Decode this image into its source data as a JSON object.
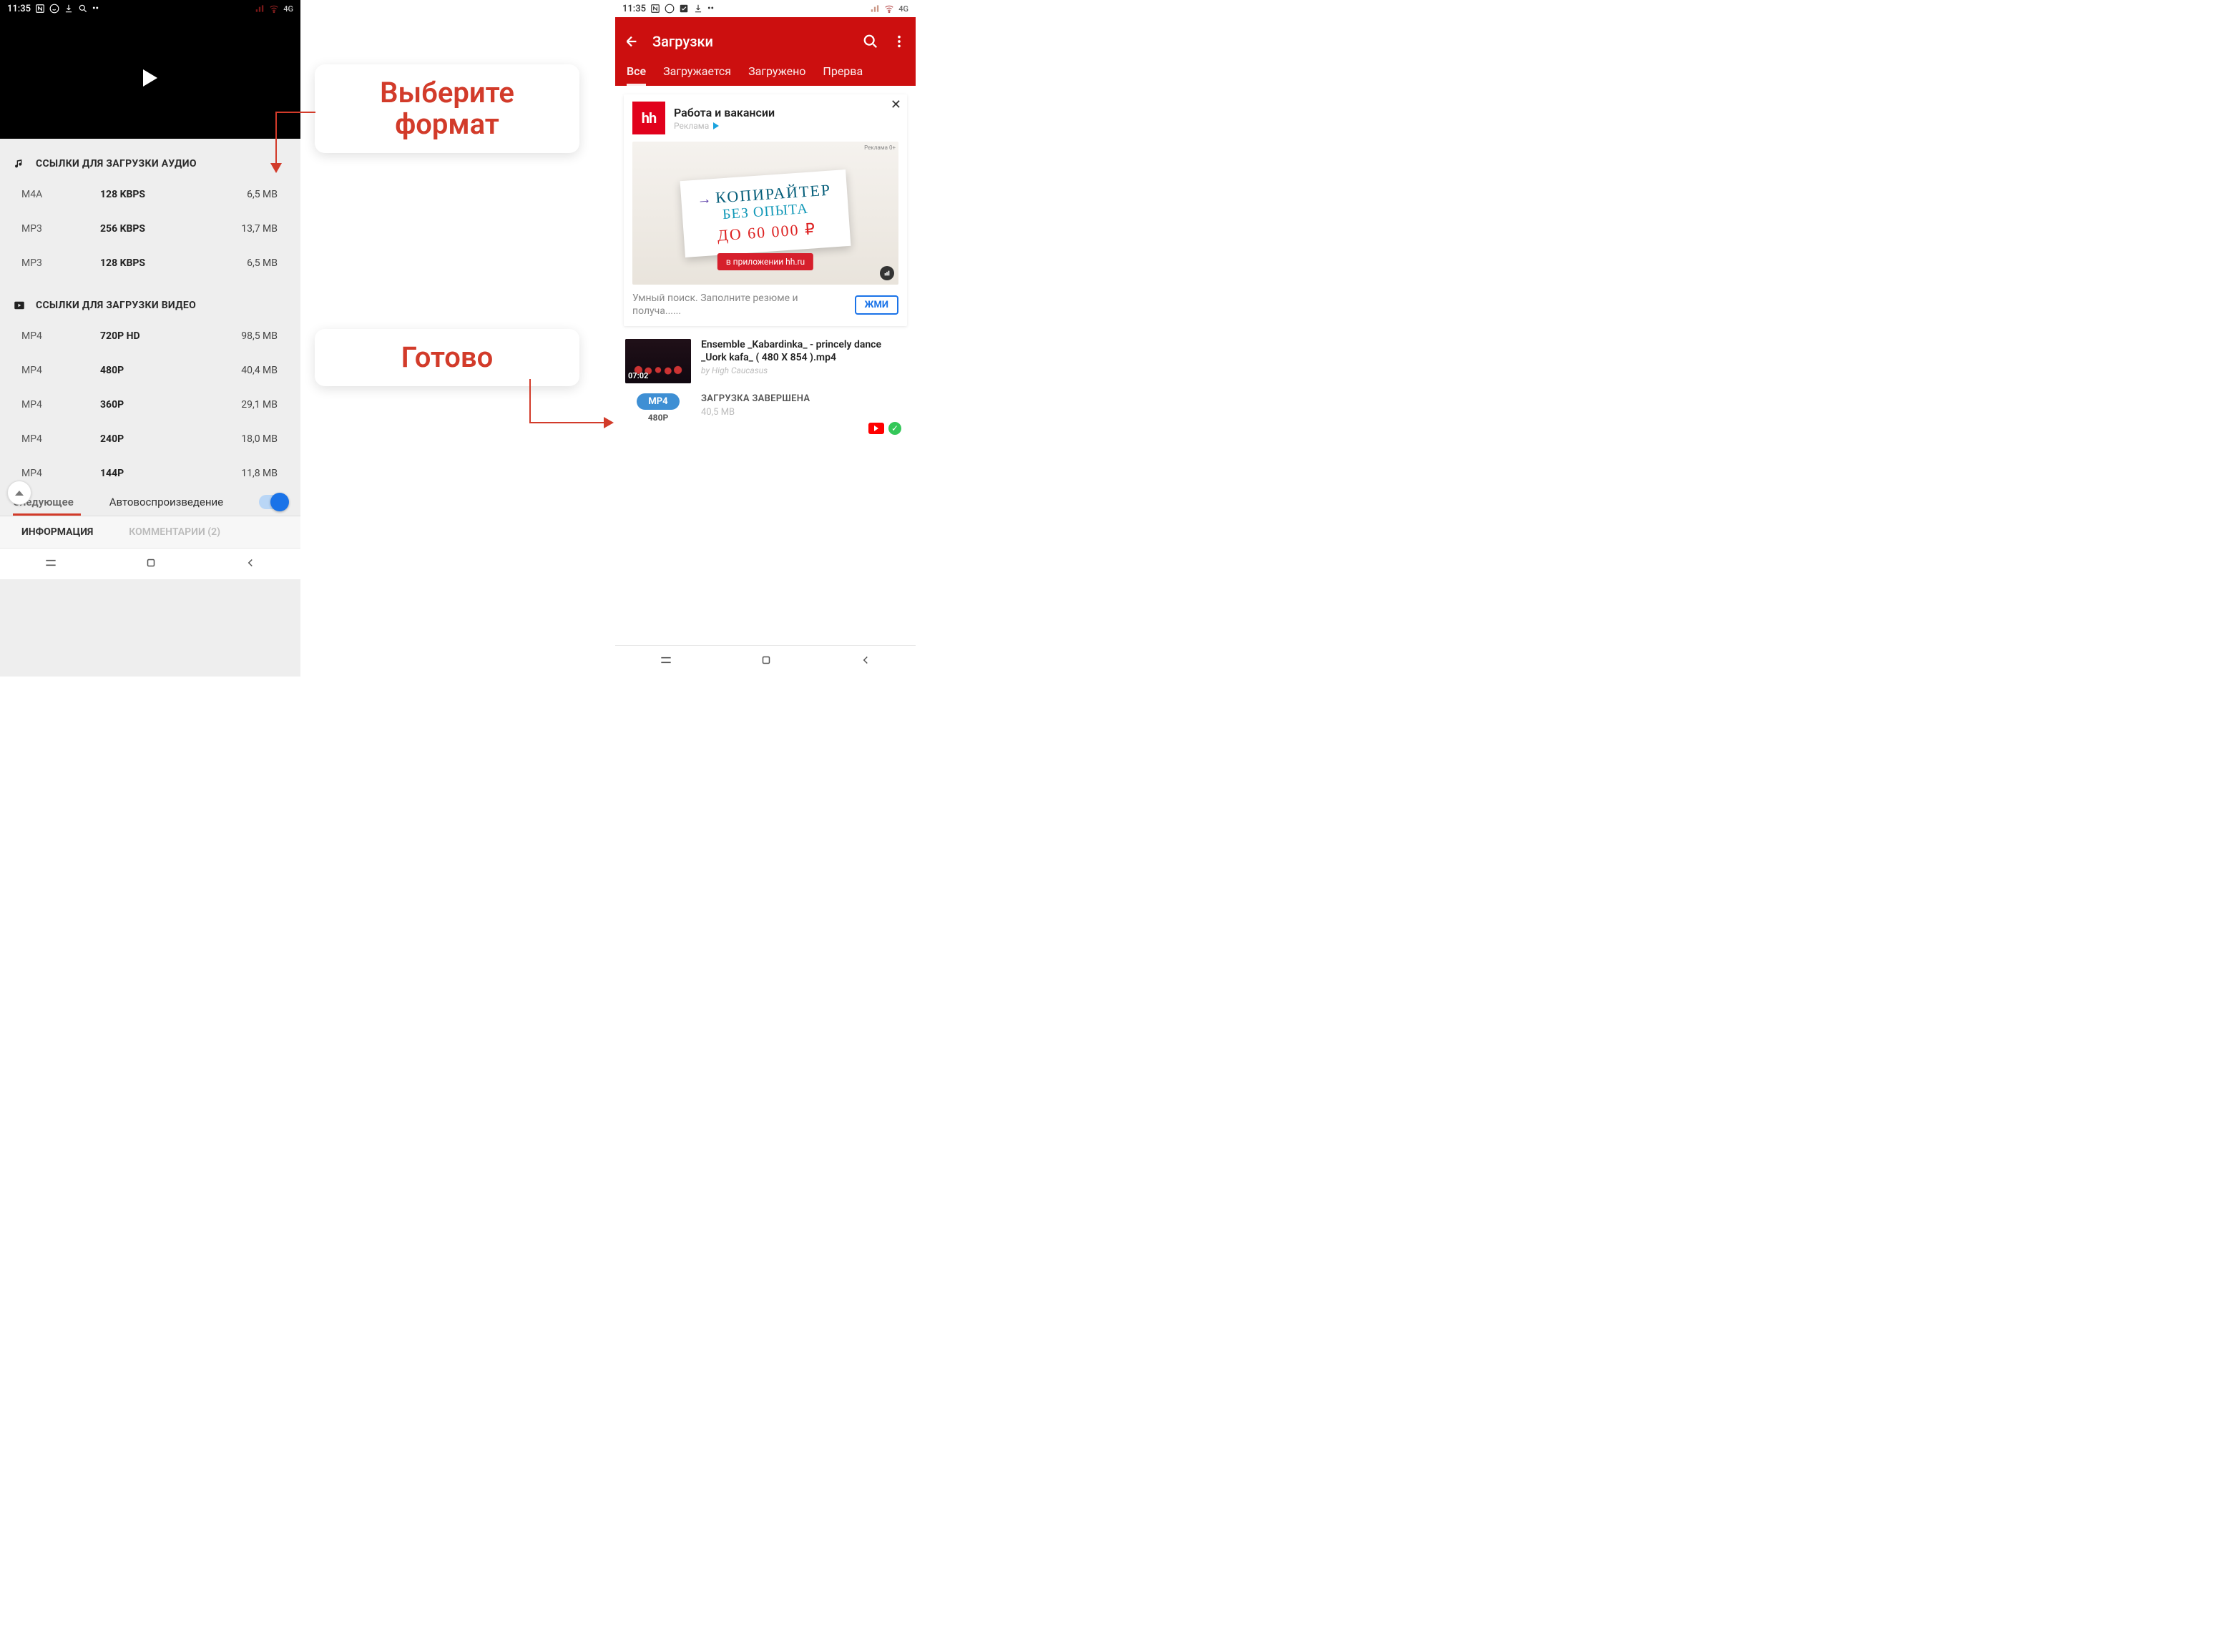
{
  "left": {
    "statusbar": {
      "time": "11:35",
      "net": "4G"
    },
    "audio_header": "ССЫЛКИ ДЛЯ ЗАГРУЗКИ АУДИО",
    "audio_links": [
      {
        "fmt": "M4A",
        "q": "128 KBPS",
        "sz": "6,5 MB"
      },
      {
        "fmt": "MP3",
        "q": "256 KBPS",
        "sz": "13,7 MB"
      },
      {
        "fmt": "MP3",
        "q": "128 KBPS",
        "sz": "6,5 MB"
      }
    ],
    "video_header": "ССЫЛКИ ДЛЯ ЗАГРУЗКИ ВИДЕО",
    "video_links": [
      {
        "fmt": "MP4",
        "q": "720P HD",
        "sz": "98,5 MB"
      },
      {
        "fmt": "MP4",
        "q": "480P",
        "sz": "40,4 MB"
      },
      {
        "fmt": "MP4",
        "q": "360P",
        "sz": "29,1 MB"
      },
      {
        "fmt": "MP4",
        "q": "240P",
        "sz": "18,0 MB"
      },
      {
        "fmt": "MP4",
        "q": "144P",
        "sz": "11,8 MB"
      }
    ],
    "next_label": "Следующее",
    "autoplay_label": "Автовоспроизведение",
    "tab_info": "ИНФОРМАЦИЯ",
    "tab_comments": "КОММЕНТАРИИ (2)"
  },
  "callouts": {
    "choose_format_l1": "Выберите",
    "choose_format_l2": "формат",
    "done": "Готово"
  },
  "right": {
    "statusbar": {
      "time": "11:35",
      "net": "4G"
    },
    "header_title": "Загрузки",
    "tabs": {
      "all": "Все",
      "loading": "Загружается",
      "loaded": "Загружено",
      "aborted": "Прерва"
    },
    "ad": {
      "logo": "hh",
      "title": "Работа и вакансии",
      "sub": "Реклама",
      "banner_l1": "КОПИРАЙТЕР",
      "banner_l2": "БЕЗ ОПЫТА",
      "banner_l3": "ДО 60 000 ₽",
      "pill": "в приложении hh.ru",
      "disclaimer": "Реклама 0+",
      "desc": "Умный поиск. Заполните резюме и получа......",
      "btn": "ЖМИ"
    },
    "download": {
      "title": "Ensemble _Kabardinka_ - princely dance _Uork kafa_ ( 480 X 854 ).mp4",
      "by": "by High Caucasus",
      "duration": "07:02",
      "fmt": "MP4",
      "res": "480P",
      "status": "ЗАГРУЗКА ЗАВЕРШЕНА",
      "size": "40,5 MB"
    }
  }
}
